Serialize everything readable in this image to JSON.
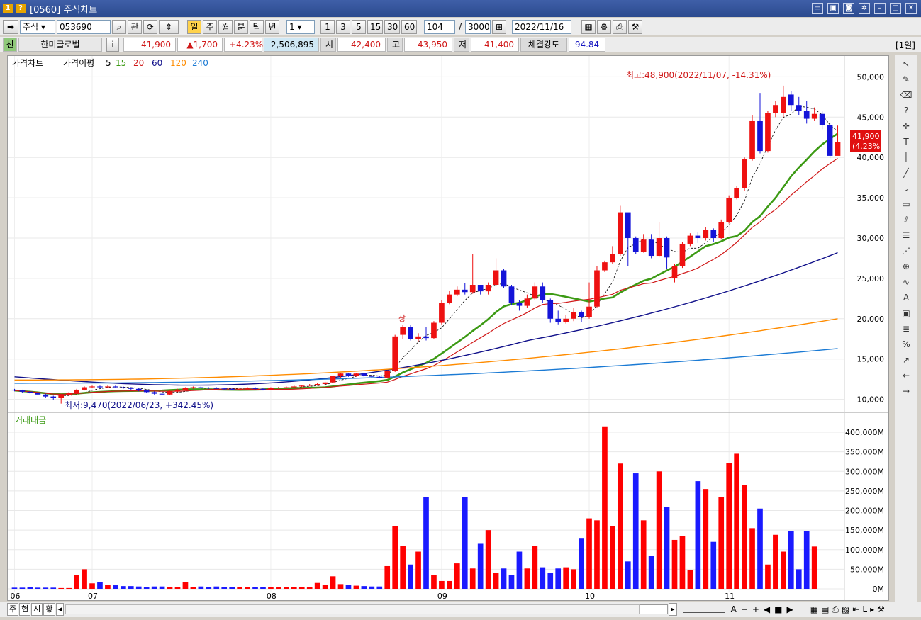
{
  "window": {
    "title": "[0560] 주식차트",
    "badge1": "1",
    "badge2": "?"
  },
  "toolbar": {
    "market": "주식",
    "code": "053690",
    "btn_gwan": "관",
    "periods": [
      "일",
      "주",
      "월",
      "분",
      "틱",
      "년"
    ],
    "unit_value": "1",
    "minute_buttons": [
      "1",
      "3",
      "5",
      "15",
      "30",
      "60"
    ],
    "count_value": "104",
    "slash": "/",
    "total_value": "3000",
    "date_value": "2022/11/16"
  },
  "quote": {
    "badge": "신",
    "name": "한미글로벌",
    "info": "i",
    "price": "41,900",
    "change": "▲1,700",
    "change_pct": "+4.23%",
    "volume": "2,506,895",
    "open_label": "시",
    "open": "42,400",
    "high_label": "고",
    "high": "43,950",
    "low_label": "저",
    "low": "41,400",
    "strength_label": "체결강도",
    "strength": "94.84",
    "period_tag": "[1일]"
  },
  "legend": {
    "price_chart": "가격차트",
    "ma_label": "가격이평",
    "ma": [
      "5",
      "15",
      "20",
      "60",
      "120",
      "240"
    ],
    "ma_colors": [
      "#000000",
      "#3c9a14",
      "#d01818",
      "#10108a",
      "#ff8c00",
      "#1a7ad4"
    ]
  },
  "annotations": {
    "high": "최고:48,900(2022/11/07, -14.31%)",
    "low": "최저:9,470(2022/06/23, +342.45%)",
    "sang": "상"
  },
  "price_tag": {
    "price": "41,900",
    "pct": "(4.23%)"
  },
  "volume_legend": "거래대금",
  "bottom_buttons": [
    "주",
    "현",
    "시",
    "황"
  ],
  "chart_data": [
    {
      "type": "candlestick",
      "ylim": [
        9000,
        51000
      ],
      "y_ticks": [
        "10,000",
        "15,000",
        "20,000",
        "25,000",
        "30,000",
        "35,000",
        "40,000",
        "45,000",
        "50,000"
      ],
      "y_tick_values": [
        10000,
        15000,
        20000,
        25000,
        30000,
        35000,
        40000,
        45000,
        50000
      ],
      "x_labels": [
        "06",
        "07",
        "08",
        "09",
        "10",
        "11"
      ],
      "x_label_index": [
        0,
        10,
        33,
        55,
        74,
        92
      ],
      "candles": [
        [
          11200,
          11100,
          11300,
          11000
        ],
        [
          11100,
          10950,
          11200,
          10850
        ],
        [
          10950,
          10800,
          11050,
          10700
        ],
        [
          10800,
          10600,
          10900,
          10500
        ],
        [
          10600,
          10350,
          10700,
          10200
        ],
        [
          10350,
          10150,
          10450,
          9900
        ],
        [
          10150,
          10500,
          10600,
          9470
        ],
        [
          10500,
          10800,
          10900,
          10400
        ],
        [
          10800,
          11200,
          11300,
          10700
        ],
        [
          11200,
          11500,
          11600,
          11100
        ],
        [
          11500,
          11600,
          11700,
          11400
        ],
        [
          11600,
          11500,
          11700,
          11400
        ],
        [
          11500,
          11600,
          11700,
          11400
        ],
        [
          11600,
          11500,
          11700,
          11400
        ],
        [
          11500,
          11400,
          11600,
          11300
        ],
        [
          11400,
          11300,
          11500,
          11200
        ],
        [
          11300,
          11100,
          11400,
          11000
        ],
        [
          11100,
          10900,
          11200,
          10800
        ],
        [
          10900,
          10700,
          11000,
          10600
        ],
        [
          10700,
          10600,
          10800,
          10500
        ],
        [
          10600,
          11000,
          11100,
          10500
        ],
        [
          11000,
          11200,
          11300,
          10900
        ],
        [
          11200,
          11400,
          11500,
          11100
        ],
        [
          11400,
          11500,
          11600,
          11300
        ],
        [
          11500,
          11450,
          11600,
          11400
        ],
        [
          11450,
          11400,
          11500,
          11300
        ],
        [
          11400,
          11350,
          11500,
          11300
        ],
        [
          11350,
          11300,
          11400,
          11200
        ],
        [
          11300,
          11250,
          11400,
          11200
        ],
        [
          11250,
          11300,
          11400,
          11200
        ],
        [
          11300,
          11400,
          11500,
          11200
        ],
        [
          11400,
          11300,
          11500,
          11200
        ],
        [
          11300,
          11250,
          11400,
          11100
        ],
        [
          11250,
          11400,
          11500,
          11200
        ],
        [
          11400,
          11450,
          11550,
          11350
        ],
        [
          11450,
          11500,
          11600,
          11400
        ],
        [
          11500,
          11600,
          11700,
          11400
        ],
        [
          11600,
          11700,
          11800,
          11500
        ],
        [
          11700,
          11800,
          11900,
          11600
        ],
        [
          11800,
          11900,
          12000,
          11700
        ],
        [
          11900,
          12100,
          12200,
          11800
        ],
        [
          12100,
          12900,
          13000,
          12000
        ],
        [
          12900,
          13200,
          13300,
          12700
        ],
        [
          13200,
          12900,
          13300,
          12800
        ],
        [
          12900,
          13200,
          13300,
          12800
        ],
        [
          13200,
          12900,
          13300,
          12800
        ],
        [
          12900,
          12800,
          13000,
          12700
        ],
        [
          12800,
          12700,
          12900,
          12600
        ],
        [
          12700,
          13500,
          13600,
          12600
        ],
        [
          13500,
          17800,
          18000,
          13400
        ],
        [
          18000,
          19000,
          19200,
          17500
        ],
        [
          19000,
          17500,
          19200,
          17300
        ],
        [
          17500,
          17800,
          18200,
          17200
        ],
        [
          17800,
          17600,
          19000,
          17300
        ],
        [
          17600,
          19500,
          19700,
          17500
        ],
        [
          19500,
          22000,
          22300,
          19300
        ],
        [
          22000,
          23000,
          23500,
          21800
        ],
        [
          23000,
          23600,
          24000,
          22800
        ],
        [
          23600,
          23300,
          24400,
          23000
        ],
        [
          23300,
          24200,
          28000,
          23100
        ],
        [
          24200,
          23400,
          24000,
          23000
        ],
        [
          23400,
          24200,
          24500,
          23000
        ],
        [
          24200,
          26000,
          27500,
          24000
        ],
        [
          26000,
          24000,
          26200,
          23800
        ],
        [
          24000,
          22000,
          24200,
          21700
        ],
        [
          22000,
          21600,
          22300,
          21000
        ],
        [
          21600,
          22500,
          23000,
          21300
        ],
        [
          22500,
          24000,
          24500,
          22300
        ],
        [
          24000,
          22300,
          24500,
          22000
        ],
        [
          22300,
          20000,
          22500,
          19500
        ],
        [
          20000,
          19600,
          21000,
          19300
        ],
        [
          19600,
          20000,
          20500,
          19400
        ],
        [
          20000,
          20800,
          21300,
          19700
        ],
        [
          20800,
          20200,
          21000,
          19600
        ],
        [
          20200,
          21500,
          24500,
          20000
        ],
        [
          21500,
          26000,
          26500,
          21400
        ],
        [
          26000,
          27000,
          27200,
          25800
        ],
        [
          27000,
          28000,
          29000,
          26800
        ],
        [
          28000,
          33200,
          34000,
          27800
        ],
        [
          33200,
          30000,
          32800,
          26500
        ],
        [
          30000,
          28300,
          30200,
          28000
        ],
        [
          28300,
          29800,
          30500,
          28200
        ],
        [
          29800,
          27800,
          30500,
          27500
        ],
        [
          27800,
          30000,
          32000,
          27600
        ],
        [
          30000,
          27600,
          30200,
          26200
        ],
        [
          25000,
          26500,
          26800,
          24500
        ],
        [
          26500,
          29300,
          29500,
          26300
        ],
        [
          29300,
          30300,
          30600,
          29000
        ],
        [
          30300,
          30000,
          30700,
          29400
        ],
        [
          30000,
          31000,
          31400,
          29700
        ],
        [
          31000,
          30000,
          31200,
          29500
        ],
        [
          30000,
          32000,
          32300,
          29800
        ],
        [
          32000,
          35000,
          35300,
          31800
        ],
        [
          35000,
          36200,
          36500,
          34800
        ],
        [
          36200,
          39800,
          40000,
          35800
        ],
        [
          39800,
          44500,
          45200,
          39600
        ],
        [
          44500,
          40800,
          48000,
          40500
        ],
        [
          40800,
          45500,
          45800,
          40600
        ],
        [
          45500,
          46500,
          47000,
          45000
        ],
        [
          45500,
          47500,
          48900,
          45000
        ],
        [
          47800,
          46500,
          48200,
          45800
        ],
        [
          46500,
          45800,
          47500,
          45200
        ],
        [
          45800,
          44800,
          47000,
          44200
        ],
        [
          44800,
          45400,
          46200,
          44500
        ],
        [
          45400,
          44000,
          45700,
          43500
        ],
        [
          44000,
          40200,
          44300,
          39900
        ],
        [
          40200,
          41900,
          43950,
          41400
        ]
      ],
      "ma_note": "5,15,20,60,120,240 moving averages shown"
    },
    {
      "type": "bar",
      "ylim": [
        0,
        420
      ],
      "y_ticks": [
        "0M",
        "50,000M",
        "100,000M",
        "150,000M",
        "200,000M",
        "250,000M",
        "300,000M",
        "350,000M",
        "400,000M"
      ],
      "y_tick_values": [
        0,
        50,
        100,
        150,
        200,
        250,
        300,
        350,
        400
      ],
      "values": [
        3,
        3,
        4,
        3,
        3,
        3,
        2,
        2,
        35,
        50,
        14,
        18,
        10,
        9,
        7,
        7,
        6,
        5,
        6,
        6,
        5,
        5,
        17,
        5,
        6,
        5,
        6,
        5,
        5,
        5,
        5,
        5,
        5,
        5,
        5,
        4,
        4,
        5,
        5,
        15,
        10,
        32,
        12,
        10,
        8,
        7,
        6,
        6,
        58,
        160,
        110,
        62,
        95,
        235,
        35,
        20,
        20,
        65,
        235,
        52,
        115,
        150,
        40,
        52,
        35,
        95,
        52,
        110,
        55,
        40,
        52,
        55,
        50,
        130,
        180,
        175,
        415,
        160,
        320,
        70,
        295,
        175,
        85,
        300,
        210,
        125,
        135,
        48,
        275,
        255,
        120,
        235,
        322,
        345,
        265,
        155,
        205,
        62,
        138,
        95,
        148,
        50,
        148,
        108
      ],
      "colors_up": "#ff0000",
      "colors_down": "#1a1aff"
    }
  ]
}
